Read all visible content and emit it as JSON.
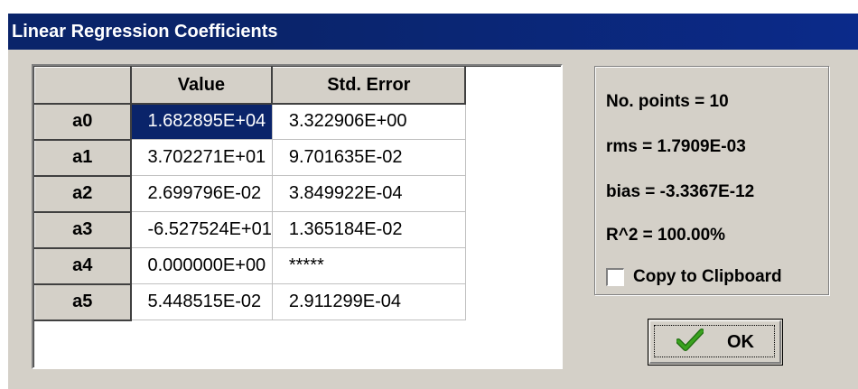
{
  "window": {
    "title": "Linear Regression Coefficients"
  },
  "grid": {
    "headers": [
      "",
      "Value",
      "Std. Error"
    ],
    "rows": [
      {
        "label": "a0",
        "value": "1.682895E+04",
        "std_error": "3.322906E+00"
      },
      {
        "label": "a1",
        "value": "3.702271E+01",
        "std_error": "9.701635E-02"
      },
      {
        "label": "a2",
        "value": "2.699796E-02",
        "std_error": "3.849922E-04"
      },
      {
        "label": "a3",
        "value": "-6.527524E+01",
        "std_error": "1.365184E-02"
      },
      {
        "label": "a4",
        "value": "0.000000E+00",
        "std_error": "*****"
      },
      {
        "label": "a5",
        "value": "5.448515E-02",
        "std_error": "2.911299E-04"
      }
    ],
    "selected_cell": "a0-value"
  },
  "stats": {
    "points": "No. points = 10",
    "rms": "rms = 1.7909E-03",
    "bias": "bias = -3.3367E-12",
    "r2": "R^2 = 100.00%"
  },
  "clipboard": {
    "label": "Copy to Clipboard",
    "checked": false
  },
  "ok_button": {
    "label": "OK",
    "icon": "checkmark-icon"
  },
  "colors": {
    "title_bar": "#0a246a",
    "selection": "#0a246a",
    "dialog_face": "#d4d0c8",
    "check_green": "#3aa21f"
  }
}
